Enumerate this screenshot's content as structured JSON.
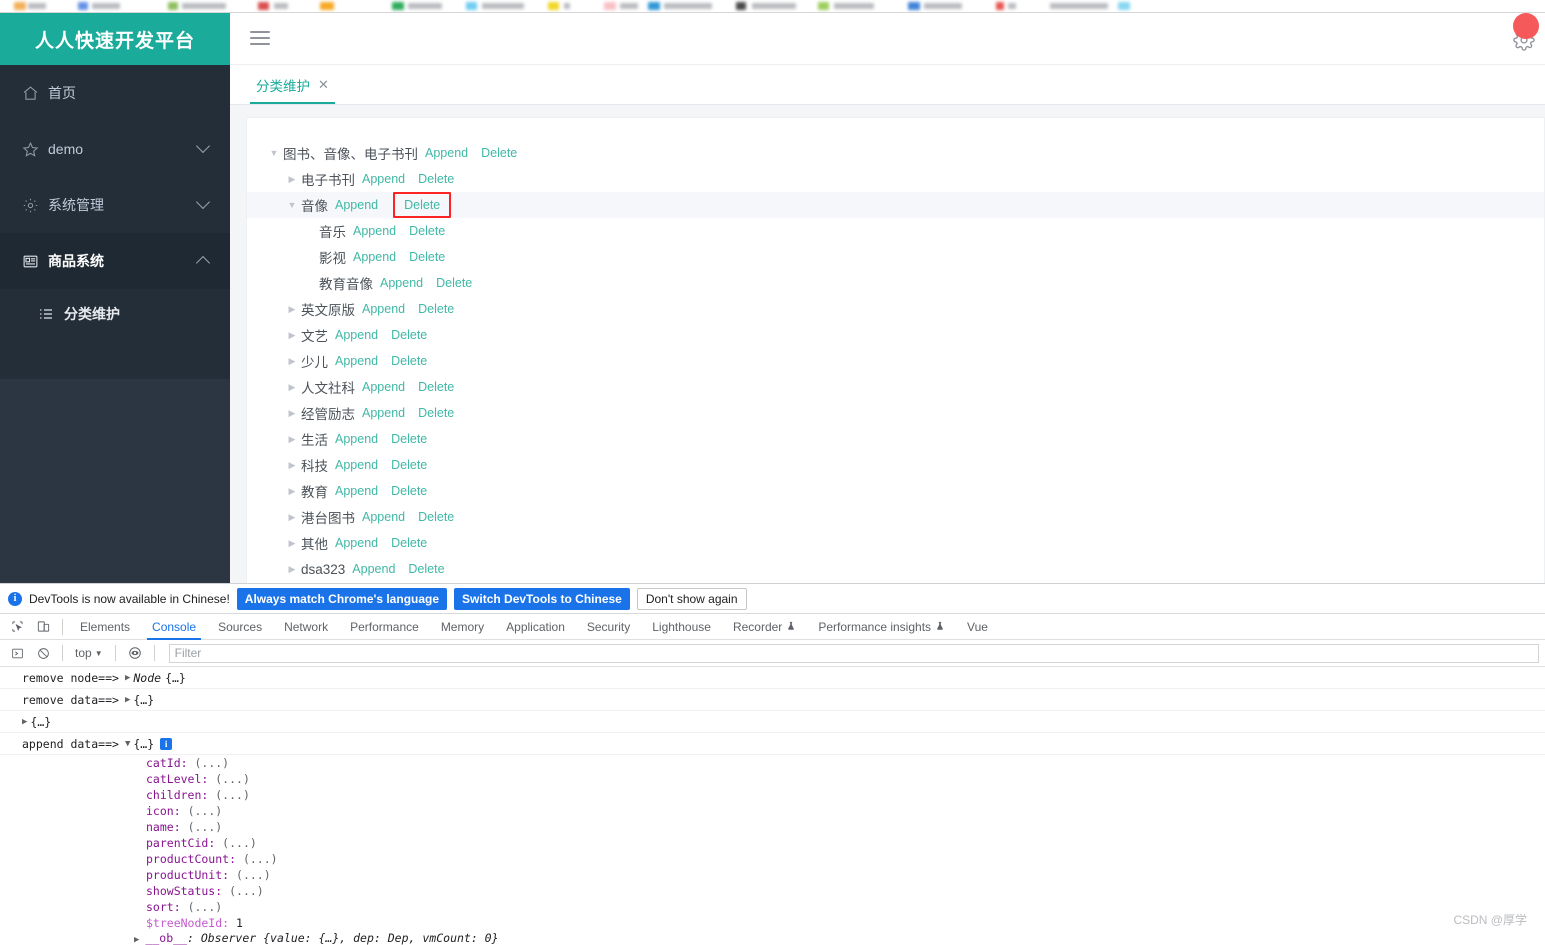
{
  "browser": {
    "bookmarks_blurred": true
  },
  "app": {
    "brand": "人人快速开发平台",
    "hamburger_icon": "hamburger-menu-icon",
    "gear_icon": "gear-icon",
    "sidebar": {
      "items": [
        {
          "label": "首页",
          "icon": "home-icon",
          "has_chevron": false,
          "expanded": false,
          "active": false
        },
        {
          "label": "demo",
          "icon": "star-icon",
          "has_chevron": true,
          "expanded": false,
          "active": false
        },
        {
          "label": "系统管理",
          "icon": "gear-icon",
          "has_chevron": true,
          "expanded": false,
          "active": false
        },
        {
          "label": "商品系统",
          "icon": "product-icon",
          "has_chevron": true,
          "expanded": true,
          "active": true
        }
      ],
      "submenu": [
        {
          "label": "分类维护",
          "icon": "list-icon",
          "active": true
        }
      ]
    },
    "tabs": [
      {
        "label": "分类维护",
        "close_icon": "close-icon",
        "active": true
      }
    ],
    "tree": {
      "append_label": "Append",
      "delete_label": "Delete",
      "nodes": [
        {
          "label": "图书、音像、电子书刊",
          "level": 0,
          "caret": "down",
          "highlight": false,
          "boxed_delete": false
        },
        {
          "label": "电子书刊",
          "level": 1,
          "caret": "right",
          "highlight": false,
          "boxed_delete": false
        },
        {
          "label": "音像",
          "level": 1,
          "caret": "down",
          "highlight": true,
          "boxed_delete": true
        },
        {
          "label": "音乐",
          "level": 2,
          "caret": "none",
          "highlight": false,
          "boxed_delete": false
        },
        {
          "label": "影视",
          "level": 2,
          "caret": "none",
          "highlight": false,
          "boxed_delete": false
        },
        {
          "label": "教育音像",
          "level": 2,
          "caret": "none",
          "highlight": false,
          "boxed_delete": false
        },
        {
          "label": "英文原版",
          "level": 1,
          "caret": "right",
          "highlight": false,
          "boxed_delete": false
        },
        {
          "label": "文艺",
          "level": 1,
          "caret": "right",
          "highlight": false,
          "boxed_delete": false
        },
        {
          "label": "少儿",
          "level": 1,
          "caret": "right",
          "highlight": false,
          "boxed_delete": false
        },
        {
          "label": "人文社科",
          "level": 1,
          "caret": "right",
          "highlight": false,
          "boxed_delete": false
        },
        {
          "label": "经管励志",
          "level": 1,
          "caret": "right",
          "highlight": false,
          "boxed_delete": false
        },
        {
          "label": "生活",
          "level": 1,
          "caret": "right",
          "highlight": false,
          "boxed_delete": false
        },
        {
          "label": "科技",
          "level": 1,
          "caret": "right",
          "highlight": false,
          "boxed_delete": false
        },
        {
          "label": "教育",
          "level": 1,
          "caret": "right",
          "highlight": false,
          "boxed_delete": false
        },
        {
          "label": "港台图书",
          "level": 1,
          "caret": "right",
          "highlight": false,
          "boxed_delete": false
        },
        {
          "label": "其他",
          "level": 1,
          "caret": "right",
          "highlight": false,
          "boxed_delete": false
        },
        {
          "label": "dsa323",
          "level": 1,
          "caret": "right",
          "highlight": false,
          "boxed_delete": false
        }
      ]
    }
  },
  "devtools": {
    "notice": {
      "icon": "info-icon",
      "message": "DevTools is now available in Chinese!",
      "primary_button": "Always match Chrome's language",
      "secondary_button": "Switch DevTools to Chinese",
      "tertiary_button": "Don't show again"
    },
    "toolbar_icons": [
      "inspect-element-icon",
      "device-toolbar-icon"
    ],
    "tabs": [
      {
        "label": "Elements",
        "selected": false,
        "experiment": false
      },
      {
        "label": "Console",
        "selected": true,
        "experiment": false
      },
      {
        "label": "Sources",
        "selected": false,
        "experiment": false
      },
      {
        "label": "Network",
        "selected": false,
        "experiment": false
      },
      {
        "label": "Performance",
        "selected": false,
        "experiment": false
      },
      {
        "label": "Memory",
        "selected": false,
        "experiment": false
      },
      {
        "label": "Application",
        "selected": false,
        "experiment": false
      },
      {
        "label": "Security",
        "selected": false,
        "experiment": false
      },
      {
        "label": "Lighthouse",
        "selected": false,
        "experiment": false
      },
      {
        "label": "Recorder",
        "selected": false,
        "experiment": true
      },
      {
        "label": "Performance insights",
        "selected": false,
        "experiment": true
      },
      {
        "label": "Vue",
        "selected": false,
        "experiment": false
      }
    ],
    "filterbar": {
      "execute_icon": "execute-icon",
      "clear_icon": "clear-console-icon",
      "context": "top",
      "chevron_icon": "chevron-down-icon",
      "eye_icon": "live-expression-icon",
      "filter_placeholder": "Filter",
      "filter_value": ""
    },
    "console_rows": [
      {
        "label": "remove node==>",
        "arrow": "right",
        "value": "Node",
        "value_italic": true,
        "braces": "{…}",
        "badge": false
      },
      {
        "label": "remove data==>",
        "arrow": "right",
        "value": "",
        "value_italic": false,
        "braces": "{…}",
        "badge": false
      },
      {
        "label": "",
        "arrow": "right",
        "value": "",
        "value_italic": false,
        "braces": "{…}",
        "badge": false
      },
      {
        "label": "append data==>",
        "arrow": "down",
        "value": "",
        "value_italic": false,
        "braces": "{…}",
        "badge": true
      }
    ],
    "object_properties": [
      {
        "key": "catId",
        "value": "(...)",
        "dim": false
      },
      {
        "key": "catLevel",
        "value": "(...)",
        "dim": false
      },
      {
        "key": "children",
        "value": "(...)",
        "dim": false
      },
      {
        "key": "icon",
        "value": "(...)",
        "dim": false
      },
      {
        "key": "name",
        "value": "(...)",
        "dim": false
      },
      {
        "key": "parentCid",
        "value": "(...)",
        "dim": false
      },
      {
        "key": "productCount",
        "value": "(...)",
        "dim": false
      },
      {
        "key": "productUnit",
        "value": "(...)",
        "dim": false
      },
      {
        "key": "showStatus",
        "value": "(...)",
        "dim": false
      },
      {
        "key": "sort",
        "value": "(...)",
        "dim": false
      },
      {
        "key": "$treeNodeId",
        "value": "1",
        "dim": true
      }
    ],
    "observer_line": {
      "key": "__ob__",
      "value": ": Observer {value: {…}, dep: Dep, vmCount: 0}"
    }
  },
  "watermark": "CSDN @厚学",
  "colors": {
    "brand_teal": "#1AAB9B",
    "sidebar_dark": "#242e38",
    "sidebar_active": "#1f2933",
    "devtools_blue": "#1a73e8",
    "highlight_red": "#fb2424",
    "action_link": "#40b8a6"
  }
}
